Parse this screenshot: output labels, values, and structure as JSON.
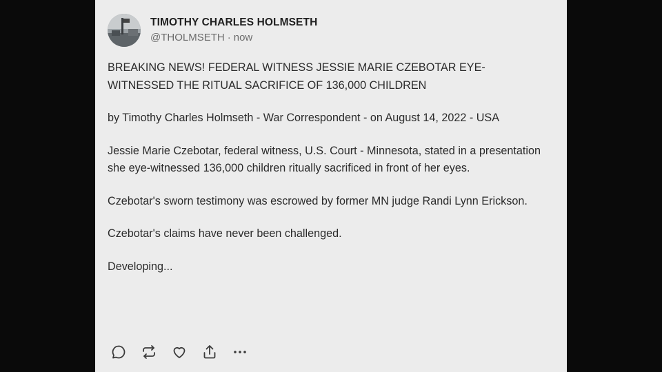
{
  "post": {
    "author": {
      "display_name": "TIMOTHY CHARLES HOLMSETH",
      "handle": "@THOLMSETH",
      "separator": "·",
      "timestamp": "now",
      "avatar_icon": "avatar-photo"
    },
    "paragraphs": [
      "BREAKING NEWS! FEDERAL WITNESS JESSIE MARIE CZEBOTAR EYE-WITNESSED THE RITUAL SACRIFICE OF 136,000 CHILDREN",
      "by Timothy Charles Holmseth - War Correspondent - on August 14, 2022 - USA",
      "Jessie Marie Czebotar, federal witness, U.S. Court - Minnesota, stated in a presentation she eye-witnessed 136,000 children ritually sacrificed in front of her eyes.",
      "Czebotar's sworn testimony was escrowed by former MN judge Randi Lynn Erickson.",
      "Czebotar's claims have never been challenged.",
      "Developing..."
    ],
    "actions": [
      {
        "name": "reply",
        "icon": "reply-icon"
      },
      {
        "name": "repost",
        "icon": "repost-icon"
      },
      {
        "name": "like",
        "icon": "heart-icon"
      },
      {
        "name": "share",
        "icon": "share-icon"
      },
      {
        "name": "more",
        "icon": "more-icon"
      }
    ]
  },
  "colors": {
    "background": "#0a0a0a",
    "card": "#ececec",
    "text": "#2b2b2b",
    "muted": "#6b6b6b"
  }
}
